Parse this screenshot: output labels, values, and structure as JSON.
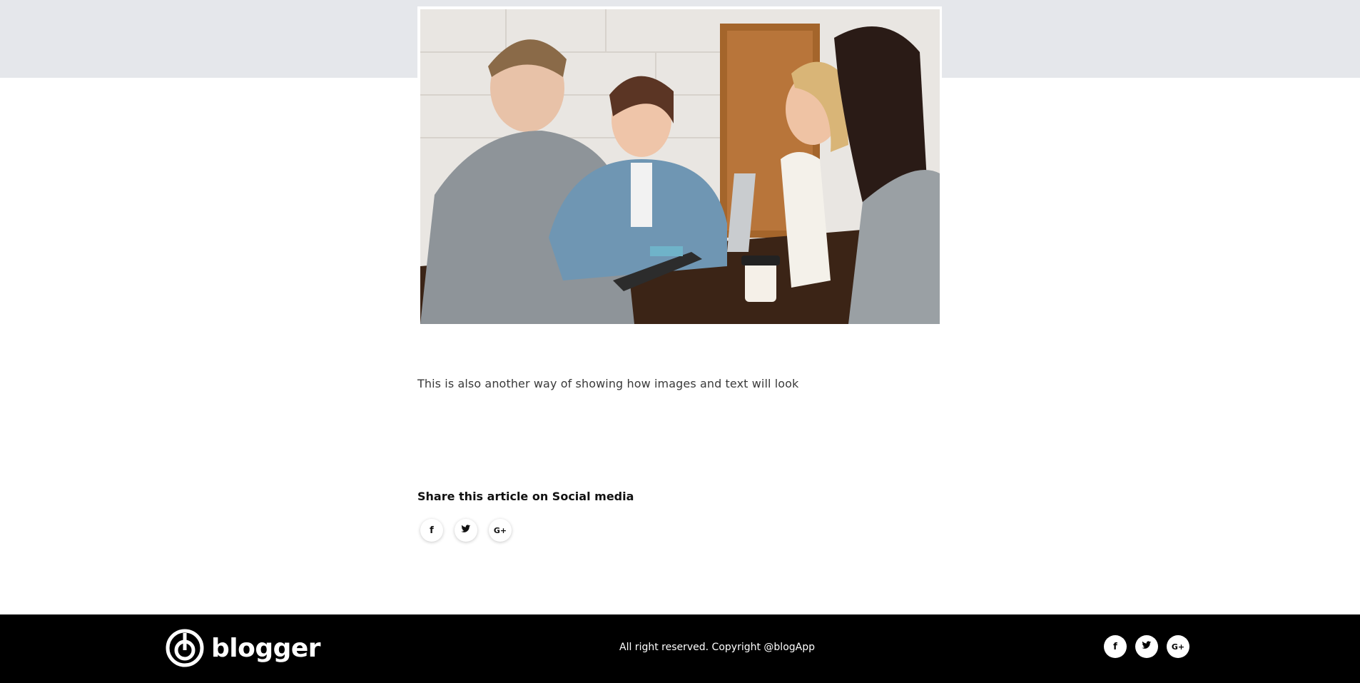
{
  "article": {
    "hero_image_alt": "people-working-together-icon",
    "body_text": "This is also another way of showing how images and text will look",
    "share_title": "Share this article on Social media",
    "share_icons": [
      {
        "name": "facebook-icon",
        "glyph": "f"
      },
      {
        "name": "twitter-icon",
        "glyph": "🐦"
      },
      {
        "name": "google-plus-icon",
        "glyph": "G+"
      }
    ]
  },
  "footer": {
    "brand_name": "blogger",
    "copyright": "All right reserved. Copyright @blogApp",
    "social_icons": [
      {
        "name": "facebook-icon",
        "glyph": "f"
      },
      {
        "name": "twitter-icon",
        "glyph": "🐦"
      },
      {
        "name": "google-plus-icon",
        "glyph": "G+"
      }
    ]
  },
  "colors": {
    "top_band": "#e5e7eb",
    "footer_bg": "#000000",
    "text": "#3a3a3a"
  }
}
